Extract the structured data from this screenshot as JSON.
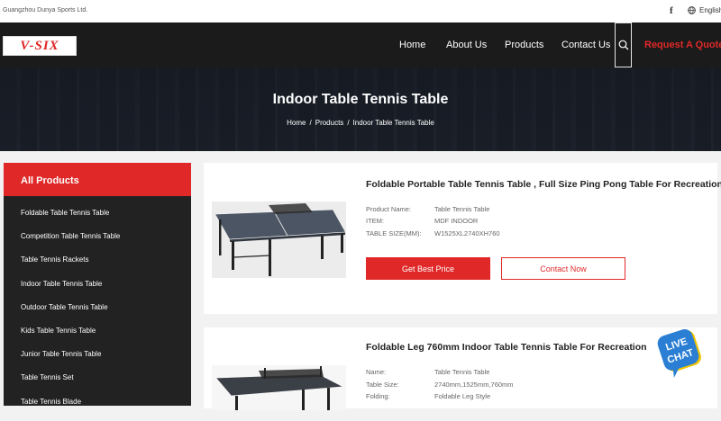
{
  "header": {
    "company": "Guangzhou Dunya Sports Ltd.",
    "facebook_glyph": "f",
    "language": "English"
  },
  "nav": {
    "logo": "V-SIX",
    "items": [
      "Home",
      "About Us",
      "Products",
      "Contact Us"
    ],
    "quote": "Request A Quote"
  },
  "banner": {
    "title": "Indoor Table Tennis Table",
    "breadcrumb": [
      "Home",
      "Products",
      "Indoor Table Tennis Table"
    ],
    "separator": "/"
  },
  "sidebar": {
    "heading": "All Products",
    "items": [
      "Foldable Table Tennis Table",
      "Competition Table Tennis Table",
      "Table Tennis Rackets",
      "Indoor Table Tennis Table",
      "Outdoor Table Tennis Table",
      "Kids Table Tennis Table",
      "Junior Table Tennis Table",
      "Table Tennis Set",
      "Table Tennis Blade"
    ]
  },
  "products": [
    {
      "title": "Foldable Portable Table Tennis Table , Full Size Ping Pong Table For Recreation",
      "specs": [
        {
          "key": "Product Name:",
          "value": "Table Tennis Table"
        },
        {
          "key": "ITEM:",
          "value": "MDF INDOOR"
        },
        {
          "key": "TABLE SIZE(MM):",
          "value": "W1525XL2740XH760"
        }
      ],
      "best_price": "Get Best Price",
      "contact": "Contact Now"
    },
    {
      "title": "Foldable Leg 760mm Indoor Table Tennis Table For Recreation",
      "specs": [
        {
          "key": "Name:",
          "value": "Table Tennis Table"
        },
        {
          "key": "Table Size:",
          "value": "2740mm,1525mm,760mm"
        },
        {
          "key": "Folding:",
          "value": "Foldable Leg Style"
        }
      ]
    }
  ],
  "chat": {
    "line1": "LIVE",
    "line2": "CHAT"
  },
  "colors": {
    "accent": "#e02828",
    "nav_bg": "#1b1b1b",
    "sidebar_bg": "#222222",
    "chat_blue": "#2a7fd4",
    "chat_yellow": "#f5c400"
  }
}
